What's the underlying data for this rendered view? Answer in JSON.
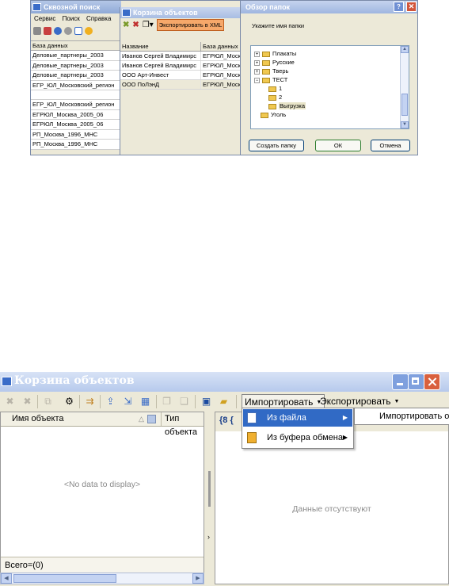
{
  "top": {
    "search_window": {
      "title": "Сквозной поиск",
      "menu": [
        "Сервис",
        "Поиск",
        "Справка"
      ],
      "list_header": "База данных",
      "items": [
        "Деловые_партнеры_2003",
        "Деловые_партнеры_2003",
        "Деловые_партнеры_2003",
        "ЕГР_ЮЛ_Московский_регион",
        "",
        "ЕГР_ЮЛ_Московский_регион",
        "ЕГРЮЛ_Москва_2005_06",
        "ЕГРЮЛ_Москва_2005_06",
        "РП_Москва_1996_МНС",
        "РП_Москва_1996_МНС"
      ]
    },
    "basket_window": {
      "title": "Корзина объектов",
      "export_label": "Экспортировать в XML",
      "columns": [
        "Название",
        "База данных"
      ],
      "rows": [
        [
          "Иванов Сергей Владимирс",
          "ЕГРЮЛ_Моск"
        ],
        [
          "Иванов Сергей Владимирс",
          "ЕГРЮЛ_Моск"
        ],
        [
          "ООО Арт-Инвест",
          "ЕГРЮЛ_Моск"
        ],
        [
          "ООО ПоЛэнД",
          "ЕГРЮЛ_Моск"
        ]
      ]
    },
    "browse_dialog": {
      "title": "Обзор папок",
      "prompt": "Укажите имя папки",
      "tree": [
        "Плакаты",
        "Русские",
        "Тверь",
        "ТЕСТ",
        "1",
        "2",
        "Выгрузка",
        "Уголь"
      ],
      "create_label": "Создать папку",
      "ok_label": "ОК",
      "cancel_label": "Отмена"
    }
  },
  "window": {
    "title": "Корзина объектов",
    "import_label": "Импортировать",
    "export_label": "Экспортировать",
    "grid": {
      "col_name": "Имя объекта",
      "col_type": "Тип объекта",
      "empty_text": "<No data to display>",
      "footer": "Всего=(0)"
    },
    "right_pane": {
      "empty_text": "Данные отсутствуют",
      "braces": "{8 {"
    },
    "import_menu": {
      "items": [
        "Из файла",
        "Из буфера обмена"
      ],
      "submenu_item": "Импортировать об"
    }
  },
  "colors": {
    "titlebar": "#b6c9ec",
    "menu_highlight": "#316ac5",
    "window_face": "#ece9d8",
    "close_button": "#d9603e"
  }
}
